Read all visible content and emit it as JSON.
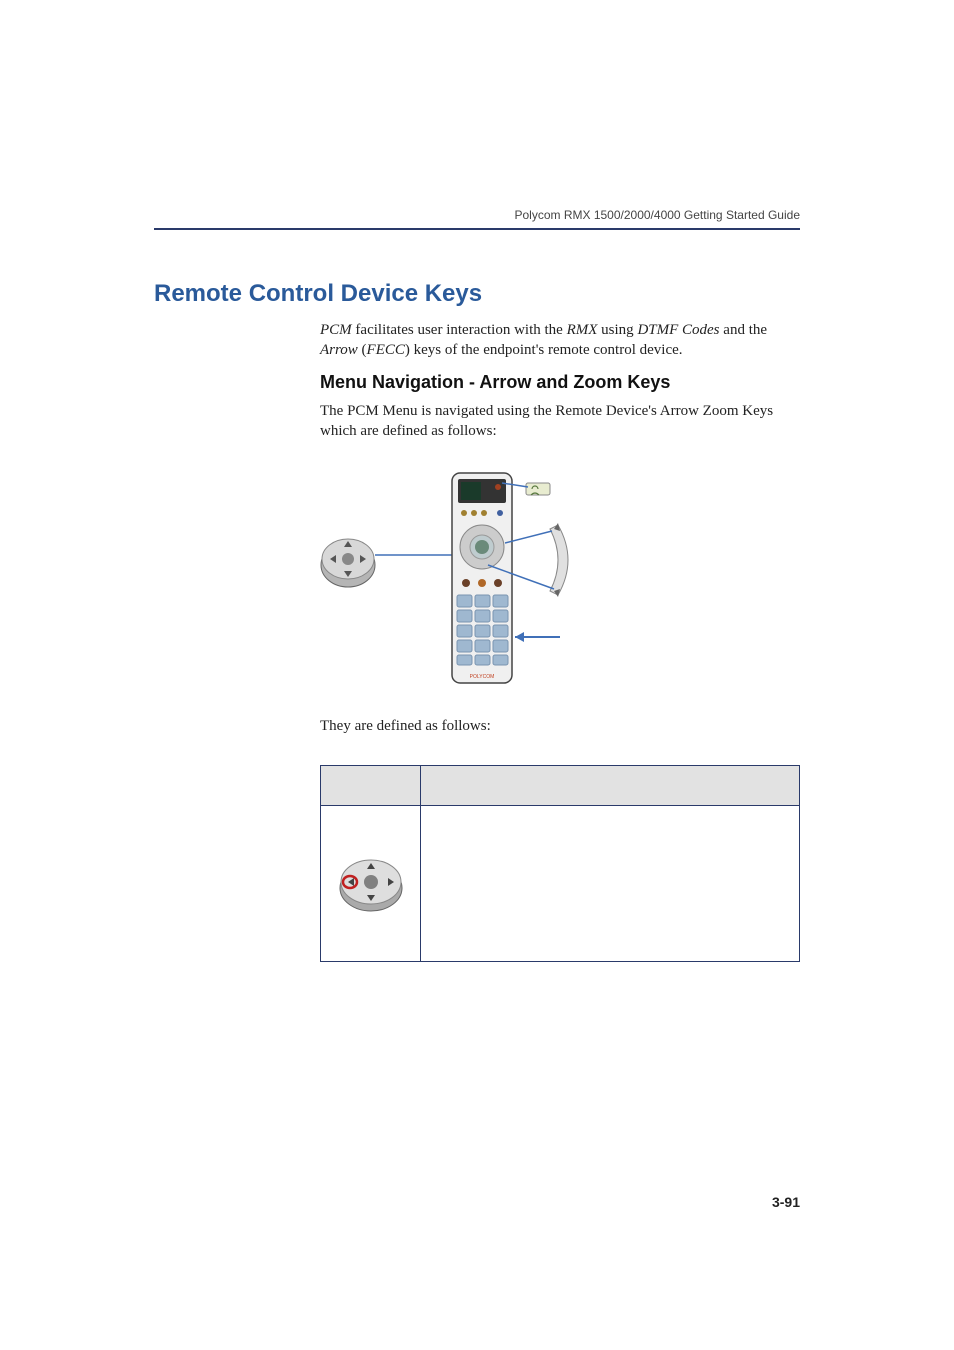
{
  "header": {
    "right_text": "Polycom RMX 1500/2000/4000 Getting Started Guide"
  },
  "h1": "Remote Control Device Keys",
  "para1": {
    "pre": "",
    "i1": "PCM",
    "t1": " facilitates user interaction with the ",
    "i2": "RMX",
    "t2": " using ",
    "i3": "DTMF Codes",
    "t3": " and the ",
    "i4": "Arrow",
    "t4": " (",
    "i5": "FECC",
    "t5": ") keys of the endpoint's remote control device."
  },
  "h2": "Menu Navigation - Arrow and Zoom Keys",
  "para2": {
    "pre": "The ",
    "i1": "PCM Menu",
    "t1": " is navigated using the ",
    "i2": "Remote Device's Arrow Zoom Keys",
    "t2": " which are defined as follows:"
  },
  "para3": "They are defined as follows:",
  "page_number": "3-91",
  "icons": {
    "remote_diagram": "remote-diagram",
    "dpad_left": "dpad-left-icon"
  }
}
